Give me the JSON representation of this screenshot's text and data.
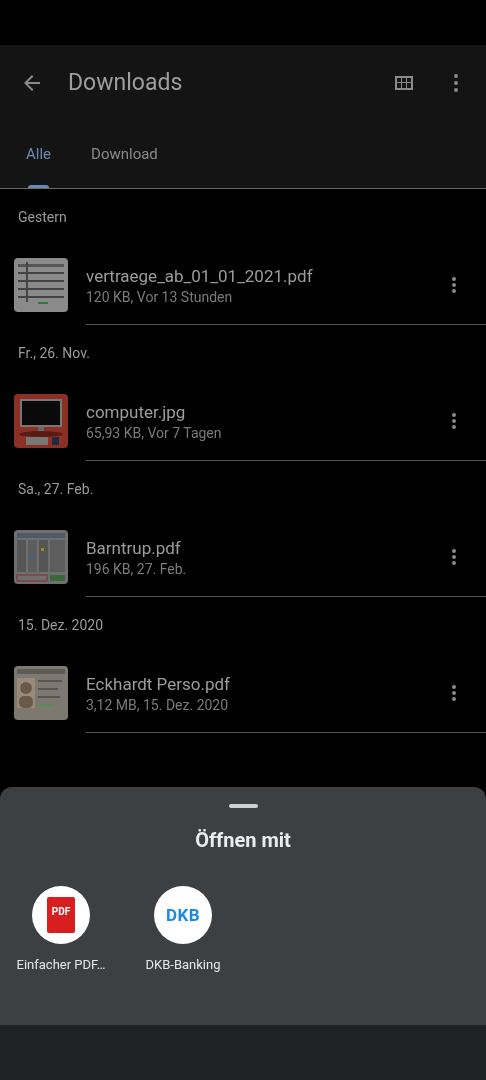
{
  "app_bar": {
    "title": "Downloads"
  },
  "tabs": [
    {
      "label": "Alle",
      "selected": true
    },
    {
      "label": "Download",
      "selected": false
    }
  ],
  "groups": [
    {
      "date": "Gestern",
      "files": [
        {
          "name": "vertraege_ab_01_01_2021.pdf",
          "meta": "120 KB, Vor 13 Stunden"
        }
      ]
    },
    {
      "date": "Fr., 26. Nov.",
      "files": [
        {
          "name": "computer.jpg",
          "meta": "65,93 KB, Vor 7 Tagen"
        }
      ]
    },
    {
      "date": "Sa., 27. Feb.",
      "files": [
        {
          "name": "Barntrup.pdf",
          "meta": "196 KB, 27. Feb."
        }
      ]
    },
    {
      "date": "15. Dez. 2020",
      "files": [
        {
          "name": "Eckhardt Perso.pdf",
          "meta": "3,12 MB, 15. Dez. 2020"
        }
      ]
    }
  ],
  "sheet": {
    "title": "Öffnen mit",
    "apps": [
      {
        "kind": "pdf",
        "icon_text": "PDF",
        "name": "Einfacher PDF…"
      },
      {
        "kind": "dkb",
        "icon_text": "DKB",
        "name": "DKB-Banking"
      }
    ]
  }
}
